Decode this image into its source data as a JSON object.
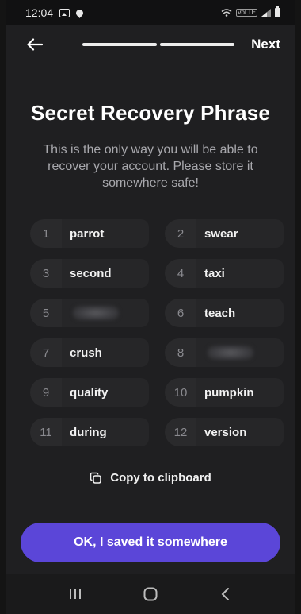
{
  "status_bar": {
    "time": "12:04",
    "icons": [
      "gallery-icon",
      "location-icon",
      "wifi-icon",
      "volte-icon",
      "signal-icon",
      "battery-icon"
    ],
    "volte_label": "VoLTE"
  },
  "header": {
    "back_icon": "arrow-left-icon",
    "next_label": "Next",
    "progress_steps": 2,
    "progress_completed": 2
  },
  "title": "Secret Recovery Phrase",
  "subtitle": "This is the only way you will be able to recover your account. Please store it somewhere safe!",
  "words": [
    {
      "number": "1",
      "word": "parrot",
      "hidden": false
    },
    {
      "number": "2",
      "word": "swear",
      "hidden": false
    },
    {
      "number": "3",
      "word": "second",
      "hidden": false
    },
    {
      "number": "4",
      "word": "taxi",
      "hidden": false
    },
    {
      "number": "5",
      "word": "",
      "hidden": true
    },
    {
      "number": "6",
      "word": "teach",
      "hidden": false
    },
    {
      "number": "7",
      "word": "crush",
      "hidden": false
    },
    {
      "number": "8",
      "word": "",
      "hidden": true
    },
    {
      "number": "9",
      "word": "quality",
      "hidden": false
    },
    {
      "number": "10",
      "word": "pumpkin",
      "hidden": false
    },
    {
      "number": "11",
      "word": "during",
      "hidden": false
    },
    {
      "number": "12",
      "word": "version",
      "hidden": false
    }
  ],
  "copy": {
    "label": "Copy to clipboard",
    "icon": "copy-icon"
  },
  "primary_button": {
    "label": "OK, I saved it somewhere"
  },
  "nav_bar": {
    "icons": [
      "recent-apps-icon",
      "home-icon",
      "back-icon"
    ]
  },
  "colors": {
    "background": "#1f1f21",
    "accent": "#5b46d8",
    "subtitle": "#a8a8ad",
    "cell": "#262628"
  }
}
